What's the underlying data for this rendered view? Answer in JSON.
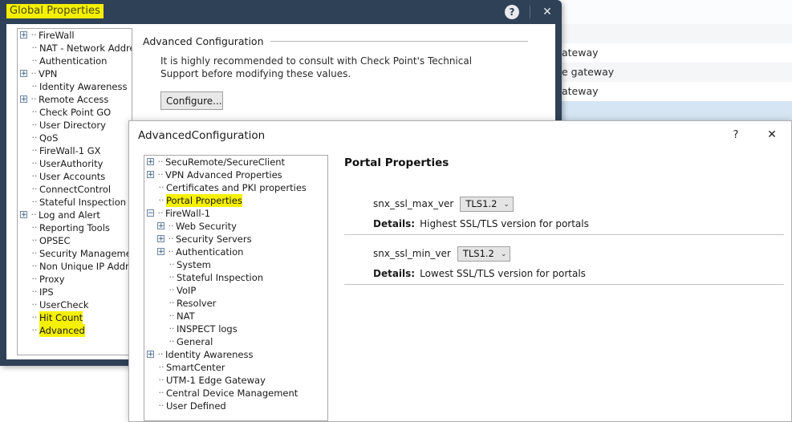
{
  "background": {
    "rows": [
      {
        "text": "",
        "style": "strip"
      },
      {
        "text": "",
        "style": "alt"
      },
      {
        "text": "ateway",
        "style": "plain"
      },
      {
        "text": "e gateway",
        "style": "alt"
      },
      {
        "text": "ateway",
        "style": "plain"
      },
      {
        "text": "",
        "style": "selected"
      }
    ]
  },
  "global_properties": {
    "title": "Global Properties",
    "help_icon": "question-mark-icon",
    "close_icon": "close-x-icon",
    "tree": [
      {
        "label": "FireWall",
        "expander": "plus",
        "indent": 0
      },
      {
        "label": "NAT - Network Addres",
        "expander": "none",
        "indent": 0
      },
      {
        "label": "Authentication",
        "expander": "none",
        "indent": 0
      },
      {
        "label": "VPN",
        "expander": "plus",
        "indent": 0
      },
      {
        "label": "Identity Awareness",
        "expander": "none",
        "indent": 0
      },
      {
        "label": "Remote Access",
        "expander": "plus",
        "indent": 0
      },
      {
        "label": "Check Point GO",
        "expander": "none",
        "indent": 0
      },
      {
        "label": "User Directory",
        "expander": "none",
        "indent": 0
      },
      {
        "label": "QoS",
        "expander": "none",
        "indent": 0
      },
      {
        "label": "FireWall-1 GX",
        "expander": "none",
        "indent": 0
      },
      {
        "label": "UserAuthority",
        "expander": "none",
        "indent": 0
      },
      {
        "label": "User Accounts",
        "expander": "none",
        "indent": 0
      },
      {
        "label": "ConnectControl",
        "expander": "none",
        "indent": 0
      },
      {
        "label": "Stateful Inspection",
        "expander": "none",
        "indent": 0
      },
      {
        "label": "Log and Alert",
        "expander": "plus",
        "indent": 0
      },
      {
        "label": "Reporting Tools",
        "expander": "none",
        "indent": 0
      },
      {
        "label": "OPSEC",
        "expander": "none",
        "indent": 0
      },
      {
        "label": "Security Management .",
        "expander": "none",
        "indent": 0
      },
      {
        "label": "Non Unique IP Addres",
        "expander": "none",
        "indent": 0
      },
      {
        "label": "Proxy",
        "expander": "none",
        "indent": 0
      },
      {
        "label": "IPS",
        "expander": "none",
        "indent": 0
      },
      {
        "label": "UserCheck",
        "expander": "none",
        "indent": 0
      },
      {
        "label": "Hit Count",
        "expander": "none",
        "indent": 0,
        "highlight": true
      },
      {
        "label": "Advanced",
        "expander": "none",
        "indent": 0,
        "highlight": true
      }
    ],
    "section": {
      "heading": "Advanced Configuration",
      "description": "It is highly recommended to consult with Check Point's Technical Support before modifying these values.",
      "configure_button": "Configure..."
    }
  },
  "advanced_configuration": {
    "title": "AdvancedConfiguration",
    "help_icon": "question-mark-icon",
    "close_icon": "close-x-icon",
    "tree": [
      {
        "label": "SecuRemote/SecureClient",
        "expander": "plus",
        "indent": 0
      },
      {
        "label": "VPN Advanced Properties",
        "expander": "plus",
        "indent": 0
      },
      {
        "label": "Certificates and PKI properties",
        "expander": "none",
        "indent": 0
      },
      {
        "label": "Portal Properties",
        "expander": "none",
        "indent": 0,
        "highlight": true
      },
      {
        "label": "FireWall-1",
        "expander": "minus",
        "indent": 0
      },
      {
        "label": "Web Security",
        "expander": "plus",
        "indent": 1
      },
      {
        "label": "Security Servers",
        "expander": "plus",
        "indent": 1
      },
      {
        "label": "Authentication",
        "expander": "plus",
        "indent": 1
      },
      {
        "label": "System",
        "expander": "none",
        "indent": 1
      },
      {
        "label": "Stateful Inspection",
        "expander": "none",
        "indent": 1
      },
      {
        "label": "VoIP",
        "expander": "none",
        "indent": 1
      },
      {
        "label": "Resolver",
        "expander": "none",
        "indent": 1
      },
      {
        "label": "NAT",
        "expander": "none",
        "indent": 1
      },
      {
        "label": "INSPECT logs",
        "expander": "none",
        "indent": 1
      },
      {
        "label": "General",
        "expander": "none",
        "indent": 1
      },
      {
        "label": "Identity Awareness",
        "expander": "plus",
        "indent": 0
      },
      {
        "label": "SmartCenter",
        "expander": "none",
        "indent": 0
      },
      {
        "label": "UTM-1 Edge Gateway",
        "expander": "none",
        "indent": 0
      },
      {
        "label": "Central Device Management",
        "expander": "none",
        "indent": 0
      },
      {
        "label": "User Defined",
        "expander": "none",
        "indent": 0
      }
    ],
    "panel": {
      "heading": "Portal Properties",
      "details_label": "Details:",
      "fields": [
        {
          "name": "snx_ssl_max_ver",
          "value": "TLS1.2",
          "details": "Highest SSL/TLS version for portals"
        },
        {
          "name": "snx_ssl_min_ver",
          "value": "TLS1.2",
          "details": "Lowest SSL/TLS version for portals"
        }
      ]
    }
  },
  "colors": {
    "titlebar": "#2f4157",
    "highlight": "#f5f000",
    "selected_row": "#d6e5f3",
    "control_face": "#e4e4e4"
  }
}
